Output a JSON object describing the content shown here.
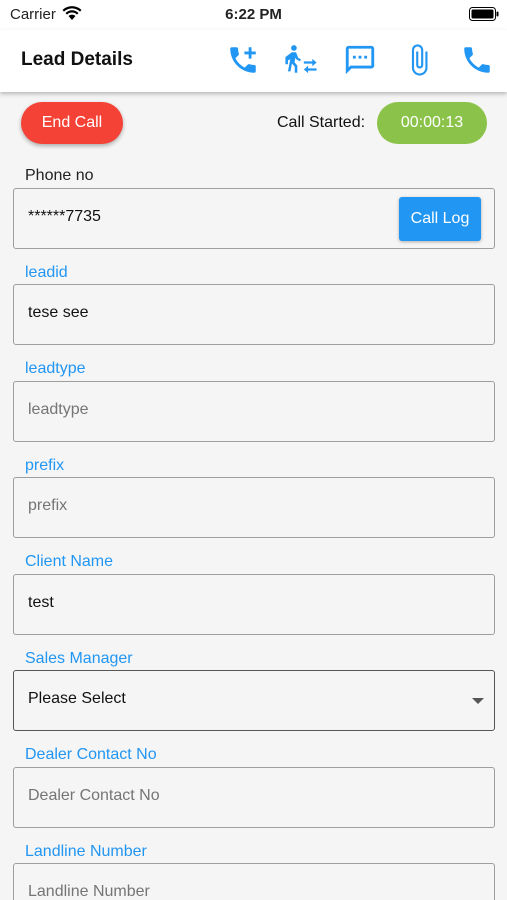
{
  "status_bar": {
    "carrier": "Carrier",
    "time": "6:22 PM"
  },
  "header": {
    "title": "Lead Details",
    "icons": [
      "add-call-icon",
      "transfer-icon",
      "message-icon",
      "attachment-icon",
      "phone-icon"
    ]
  },
  "call": {
    "end_label": "End Call",
    "started_label": "Call Started:",
    "timer": "00:00:13"
  },
  "fields": {
    "phone": {
      "label": "Phone no",
      "value": "******7735",
      "button": "Call Log"
    },
    "leadid": {
      "label": "leadid",
      "value": "tese see"
    },
    "leadtype": {
      "label": "leadtype",
      "placeholder": "leadtype"
    },
    "prefix": {
      "label": "prefix",
      "placeholder": "prefix"
    },
    "client_name": {
      "label": "Client Name",
      "value": "test"
    },
    "sales_manager": {
      "label": "Sales Manager",
      "value": "Please Select"
    },
    "dealer_contact": {
      "label": "Dealer Contact No",
      "placeholder": "Dealer Contact No"
    },
    "landline": {
      "label": "Landline Number",
      "placeholder": "Landline Number"
    }
  },
  "colors": {
    "accent": "#2196f3",
    "end_call": "#f44336",
    "timer": "#8bc34a"
  }
}
